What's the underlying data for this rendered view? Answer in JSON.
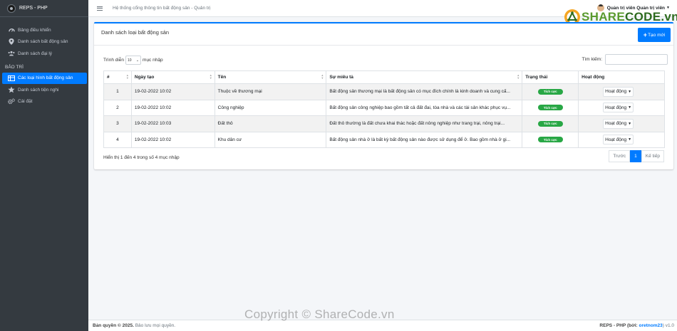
{
  "brand": {
    "name": "REPS - PHP"
  },
  "sidebar": {
    "items": [
      {
        "label": "Bảng điều khiển",
        "icon": "dashboard-icon"
      },
      {
        "label": "Danh sách bất động sản",
        "icon": "map-marker-icon"
      },
      {
        "label": "Danh sách đại lý",
        "icon": "users-icon"
      }
    ],
    "section_header": "BẢO TRÌ",
    "maint_items": [
      {
        "label": "Các loại hình bất động sản",
        "icon": "table-icon",
        "active": true
      },
      {
        "label": "Danh sách tiện nghi",
        "icon": "star-icon"
      },
      {
        "label": "Cài đặt",
        "icon": "gears-icon"
      }
    ]
  },
  "topbar": {
    "title": "Hệ thống cổng thông tin bất động sản - Quản trị",
    "user_name": "Quản trị viên Quản trị viên"
  },
  "watermark": {
    "logo_prefix": "SHARE",
    "logo_suffix": "CODE.vn",
    "copyright": "Copyright © ShareCode.vn"
  },
  "card": {
    "title": "Danh sách loại bất động sản",
    "create_label": "Tạo mới",
    "length_prefix": "Trình diễn",
    "length_value": "10",
    "length_suffix": "mục nhập",
    "search_label": "Tìm kiếm:",
    "columns": [
      "#",
      "Ngày tạo",
      "Tên",
      "Sự miêu tả",
      "Trạng thái",
      "Hoạt động"
    ],
    "rows": [
      {
        "num": "1",
        "date": "19-02-2022 10:02",
        "name": "Thuộc về thương mại",
        "desc": "Bất động sản thương mại là bất động sản có mục đích chính là kinh doanh và cung cấ...",
        "status": "Tích cực",
        "action": "Hoạt động"
      },
      {
        "num": "2",
        "date": "19-02-2022 10:02",
        "name": "Công nghiệp",
        "desc": "Bất động sản công nghiệp bao gồm tất cả đất đai, tòa nhà và các tài sản khác phục vụ...",
        "status": "Tích cực",
        "action": "Hoạt động"
      },
      {
        "num": "3",
        "date": "19-02-2022 10:03",
        "name": "Đất thô",
        "desc": "Đất thô thường là đất chưa khai thác hoặc đất nông nghiệp như trang trại, nông trại...",
        "status": "Tích cực",
        "action": "Hoạt động"
      },
      {
        "num": "4",
        "date": "19-02-2022 10:02",
        "name": "Khu dân cư",
        "desc": "Bất động sản nhà ở là bất kỳ bất động sản nào được sử dụng để ở. Bao gồm nhà ở gi...",
        "status": "Tích cực",
        "action": "Hoạt động"
      }
    ],
    "info": "Hiển thị 1 đến 4 trong số 4 mục nhập",
    "pager": {
      "prev": "Trước",
      "current": "1",
      "next": "Kế tiếp"
    }
  },
  "footer": {
    "copyright_bold": "Bản quyền © 2025.",
    "copyright_rest": "Bảo lưu mọi quyền.",
    "right_prefix": "REPS - PHP (bởi:",
    "author": "oretnom23",
    "right_suffix": ") v1.0"
  },
  "colors": {
    "primary": "#007bff",
    "sidebar": "#343a40",
    "success": "#28a745"
  }
}
